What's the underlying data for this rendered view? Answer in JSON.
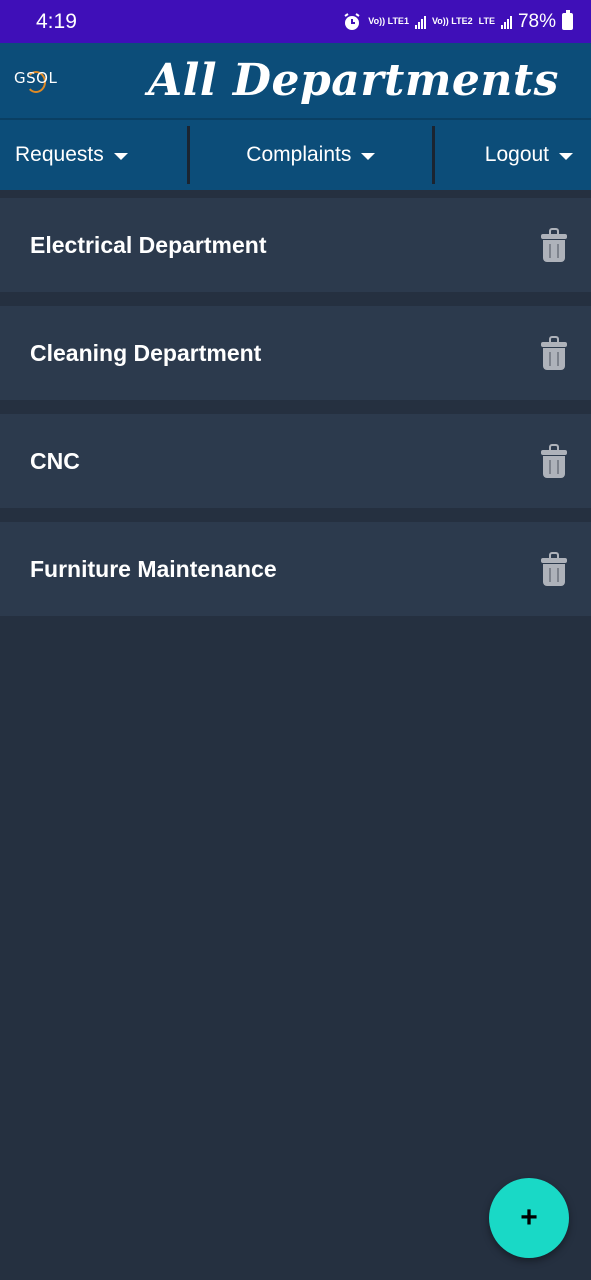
{
  "status_bar": {
    "time": "4:19",
    "sim1_label": "Vo)) LTE1",
    "sim2_label": "Vo)) LTE2",
    "lte": "LTE",
    "battery": "78%"
  },
  "header": {
    "logo_text": "GSOL",
    "title": "All Departments"
  },
  "nav": {
    "requests": "Requests",
    "complaints": "Complaints",
    "logout": "Logout"
  },
  "departments": [
    {
      "name": "Electrical Department"
    },
    {
      "name": "Cleaning Department"
    },
    {
      "name": "CNC"
    },
    {
      "name": "Furniture Maintenance"
    }
  ],
  "fab": {
    "label": "+"
  },
  "colors": {
    "status_bar": "#3f0fb8",
    "header": "#0c4d79",
    "background": "#253040",
    "card": "#2c3a4d",
    "fab": "#19d9c6"
  },
  "icons": {
    "alarm": "alarm-icon",
    "signal": "signal-icon",
    "battery": "battery-icon",
    "caret": "chevron-down-icon",
    "delete": "trash-icon",
    "add": "plus-icon"
  }
}
